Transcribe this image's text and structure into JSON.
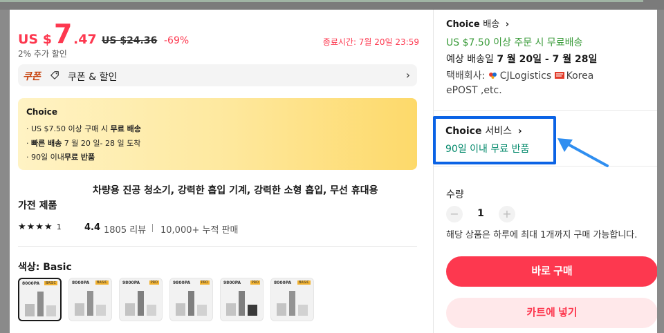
{
  "price": {
    "currency": "US $",
    "integer": "7",
    "decimal": ".47",
    "original": "US $24.36",
    "discount": "-69%",
    "end_time": "종료시간: 7월 20일 23:59",
    "extra_discount": "2% 추가 할인"
  },
  "coupon": {
    "tag": "쿠폰",
    "label": "쿠폰 & 할인",
    "chevron": "›"
  },
  "choice_box": {
    "title": "Choice",
    "lines": [
      {
        "prefix": "· US $7.50 이상 구매 시 ",
        "bold": "무료 배송",
        "suffix": ""
      },
      {
        "prefix": "· ",
        "bold": "빠른 배송",
        "suffix": " 7 월 20 일- 28 일 도착"
      },
      {
        "prefix": "· 90일 이내",
        "bold": "무료 반품",
        "suffix": ""
      }
    ]
  },
  "product": {
    "title_line1": "차량용 진공 청소기, 강력한 흡입 기계, 강력한 소형 흡입, 무선 휴대용",
    "title_line2": "가전 제품",
    "stars": "★★★★",
    "partial_star": "1",
    "score": "4.4",
    "reviews": "1805 리뷰",
    "sold": "10,000+ 누적 판매"
  },
  "color": {
    "label": "색상: Basic",
    "thumbs": [
      {
        "model": "8000PA",
        "badge": "BASIC"
      },
      {
        "model": "8000PA",
        "badge": "BASIC"
      },
      {
        "model": "9800PA",
        "badge": "PRO"
      },
      {
        "model": "9800PA",
        "badge": "PRO"
      },
      {
        "model": "9800PA",
        "badge": "PRO"
      },
      {
        "model": "8000PA",
        "badge": "BASIC"
      }
    ]
  },
  "shipping": {
    "title_brand": "Choice",
    "title_word": "배송",
    "chevron": "›",
    "free_line": "US $7.50 이상 주문 시 무료배송",
    "eta_label": "예상 배송일 ",
    "eta_value": "7 월 20일 - 7 월 28일",
    "carrier_label": "택배회사: ",
    "carrier1": "CJLogistics",
    "carrier2": "Korea",
    "carrier_rest": "ePOST ,etc."
  },
  "service": {
    "title_brand": "Choice",
    "title_word": "서비스",
    "chevron": "›",
    "sub": "90일 이내 무료 반품"
  },
  "quantity": {
    "label": "수량",
    "minus": "−",
    "value": "1",
    "plus": "+",
    "limit": "해당 상품은 하루에 최대 1개까지 구매 가능합니다."
  },
  "buttons": {
    "buy": "바로 구매",
    "cart": "카트에 넣기"
  },
  "colors": {
    "accent_red": "#fd384f",
    "highlight_blue": "#0b63e5",
    "green": "#14a54c",
    "teal": "#00886a"
  }
}
